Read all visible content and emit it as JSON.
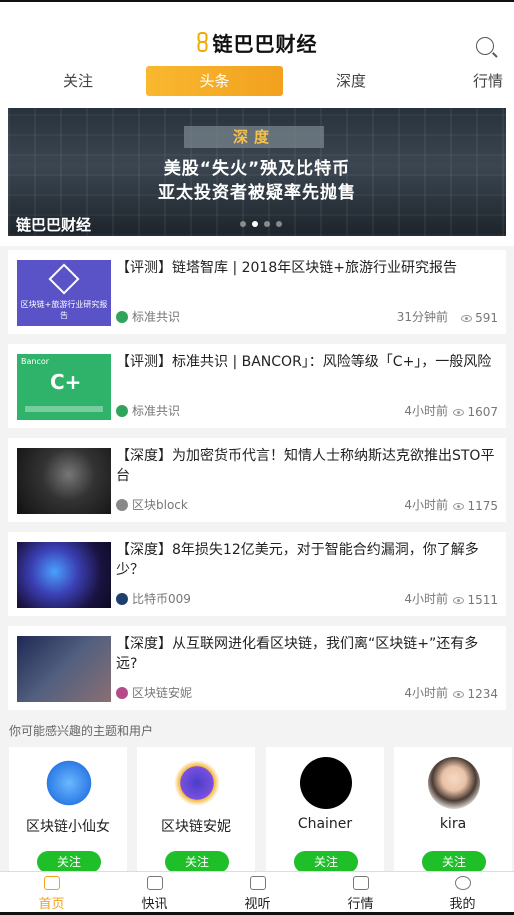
{
  "header": {
    "brand": "链巴巴财经"
  },
  "tabs": [
    "关注",
    "头条",
    "深度",
    "行情"
  ],
  "active_tab": 1,
  "banner": {
    "tag": "深度",
    "line1": "美股“失火”殃及比特币",
    "line2": "亚太投资者被疑率先抛售",
    "brand": "链巴巴财经",
    "slide_count": 4,
    "active_slide": 1
  },
  "articles": [
    {
      "title": "【评测】链塔智库 | 2018年区块链+旅游行业研究报告",
      "source": "标准共识",
      "time": "31分钟前",
      "views": "591",
      "thumb_caption": "区块链+旅游行业研究报告",
      "thumb_logo": "链塔智库"
    },
    {
      "title": "【评测】标准共识 | BANCOR」：风险等级「C+」，一般风险",
      "source": "标准共识",
      "time": "4小时前",
      "views": "1607",
      "thumb_brand": "Bancor",
      "thumb_grade": "C+"
    },
    {
      "title": "【深度】为加密货币代言！知情人士称纳斯达克欲推出STO平台",
      "source": "区块block",
      "time": "4小时前",
      "views": "1175"
    },
    {
      "title": "【深度】8年损失12亿美元，对于智能合约漏洞，你了解多少？",
      "source": "比特币009",
      "time": "4小时前",
      "views": "1511"
    },
    {
      "title": "【深度】从互联网进化看区块链，我们离“区块链+”还有多远?",
      "source": "区块链安妮",
      "time": "4小时前",
      "views": "1234"
    }
  ],
  "suggest": {
    "title": "你可能感兴趣的主题和用户",
    "follow_label": "关注",
    "users": [
      "区块链小仙女",
      "区块链安妮",
      "Chainer",
      "kira"
    ]
  },
  "bottom_nav": [
    "首页",
    "快讯",
    "视听",
    "行情",
    "我的"
  ],
  "active_nav": 0,
  "colors": {
    "accent": "#f2a11e",
    "follow": "#1fbf2a"
  }
}
